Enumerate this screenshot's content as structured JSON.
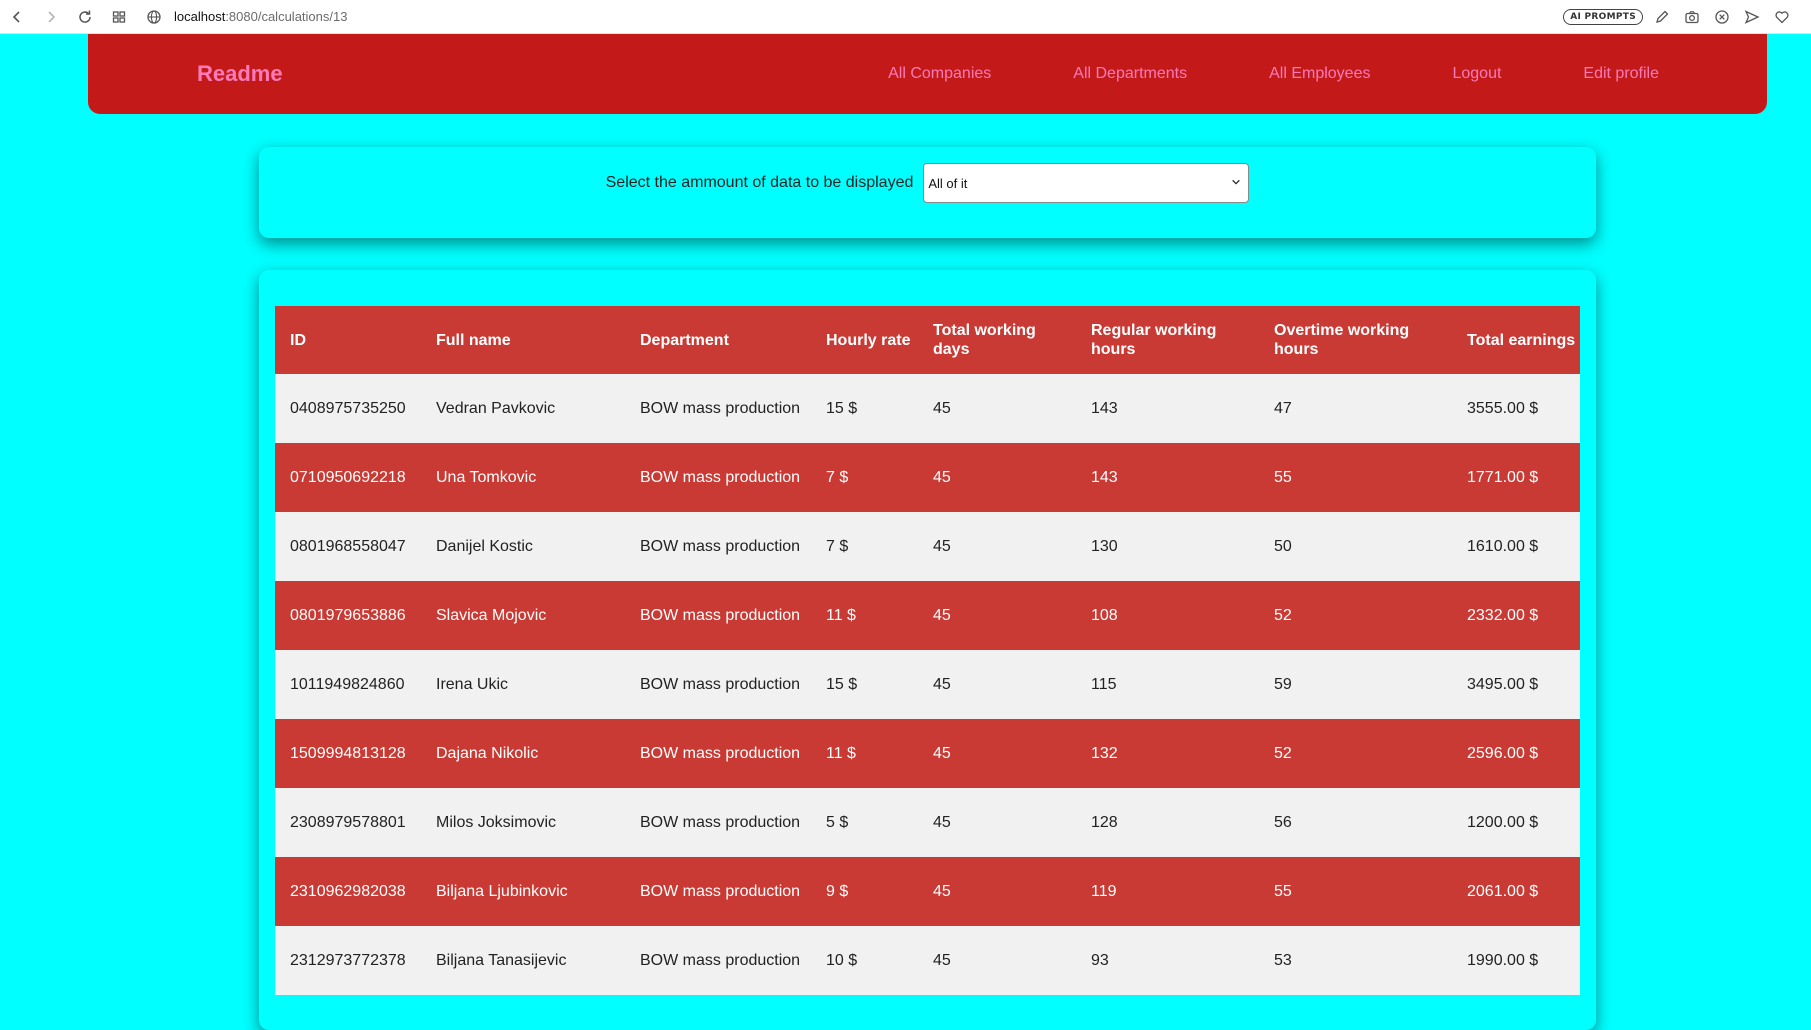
{
  "browser": {
    "url_host": "localhost",
    "url_path": ":8080/calculations/13",
    "ai_badge": "AI PROMPTS"
  },
  "navbar": {
    "brand": "Readme",
    "links": [
      "All Companies",
      "All Departments",
      "All Employees",
      "Logout",
      "Edit profile"
    ]
  },
  "filter": {
    "label": "Select the ammount of data to be displayed",
    "selected": "All of it"
  },
  "table": {
    "headers": [
      "ID",
      "Full name",
      "Department",
      "Hourly rate",
      "Total working days",
      "Regular working hours",
      "Overtime working hours",
      "Total earnings"
    ],
    "rows": [
      [
        "0408975735250",
        "Vedran Pavkovic",
        "BOW mass production",
        "15 $",
        "45",
        "143",
        "47",
        "3555.00 $"
      ],
      [
        "0710950692218",
        "Una Tomkovic",
        "BOW mass production",
        "7 $",
        "45",
        "143",
        "55",
        "1771.00 $"
      ],
      [
        "0801968558047",
        "Danijel Kostic",
        "BOW mass production",
        "7 $",
        "45",
        "130",
        "50",
        "1610.00 $"
      ],
      [
        "0801979653886",
        "Slavica Mojovic",
        "BOW mass production",
        "11 $",
        "45",
        "108",
        "52",
        "2332.00 $"
      ],
      [
        "1011949824860",
        "Irena Ukic",
        "BOW mass production",
        "15 $",
        "45",
        "115",
        "59",
        "3495.00 $"
      ],
      [
        "1509994813128",
        "Dajana Nikolic",
        "BOW mass production",
        "11 $",
        "45",
        "132",
        "52",
        "2596.00 $"
      ],
      [
        "2308979578801",
        "Milos Joksimovic",
        "BOW mass production",
        "5 $",
        "45",
        "128",
        "56",
        "1200.00 $"
      ],
      [
        "2310962982038",
        "Biljana Ljubinkovic",
        "BOW mass production",
        "9 $",
        "45",
        "119",
        "55",
        "2061.00 $"
      ],
      [
        "2312973772378",
        "Biljana Tanasijevic",
        "BOW mass production",
        "10 $",
        "45",
        "93",
        "53",
        "1990.00 $"
      ]
    ]
  }
}
